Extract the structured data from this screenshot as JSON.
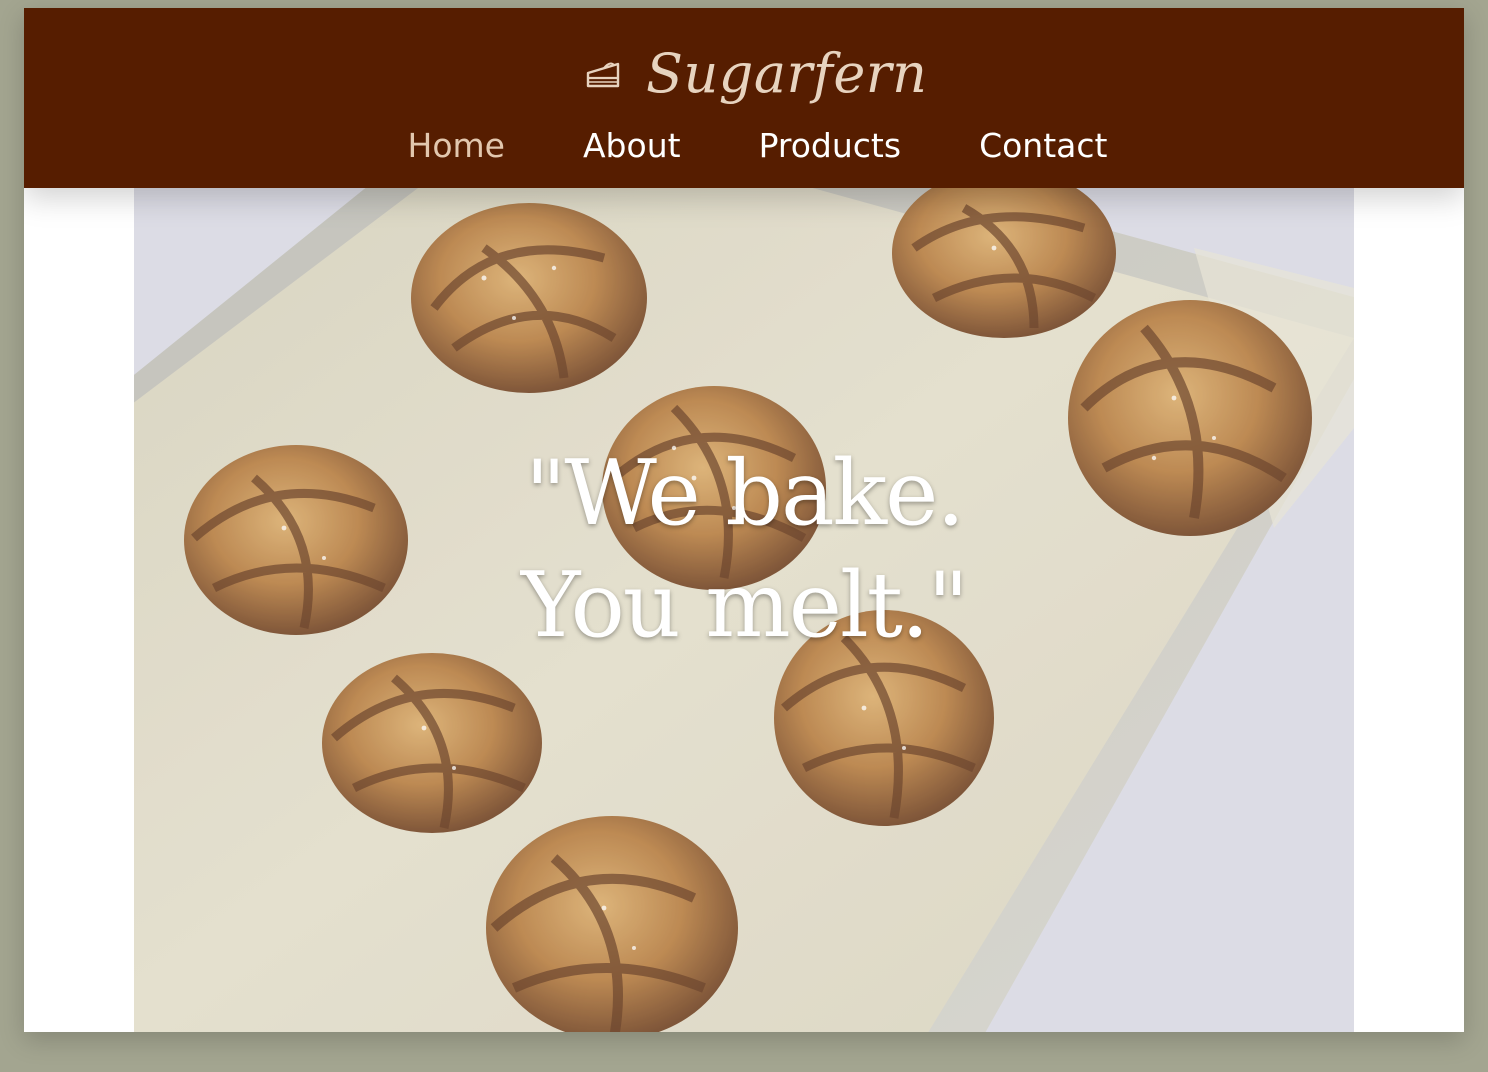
{
  "brand": {
    "name": "Sugarfern",
    "icon": "cake-slice-icon"
  },
  "nav": {
    "items": [
      {
        "label": "Home",
        "active": true
      },
      {
        "label": "About",
        "active": false
      },
      {
        "label": "Products",
        "active": false
      },
      {
        "label": "Contact",
        "active": false
      }
    ]
  },
  "hero": {
    "quote_line1": "\"We bake.",
    "quote_line2": "You melt.\"",
    "image": "cinnamon-knot-buns-on-baking-tray"
  },
  "colors": {
    "backdrop": "#a3a590",
    "header_bg": "#561d00",
    "brand_text": "#e7d3bf",
    "nav_active": "#e2c7ae",
    "nav_text": "#ffffff"
  }
}
